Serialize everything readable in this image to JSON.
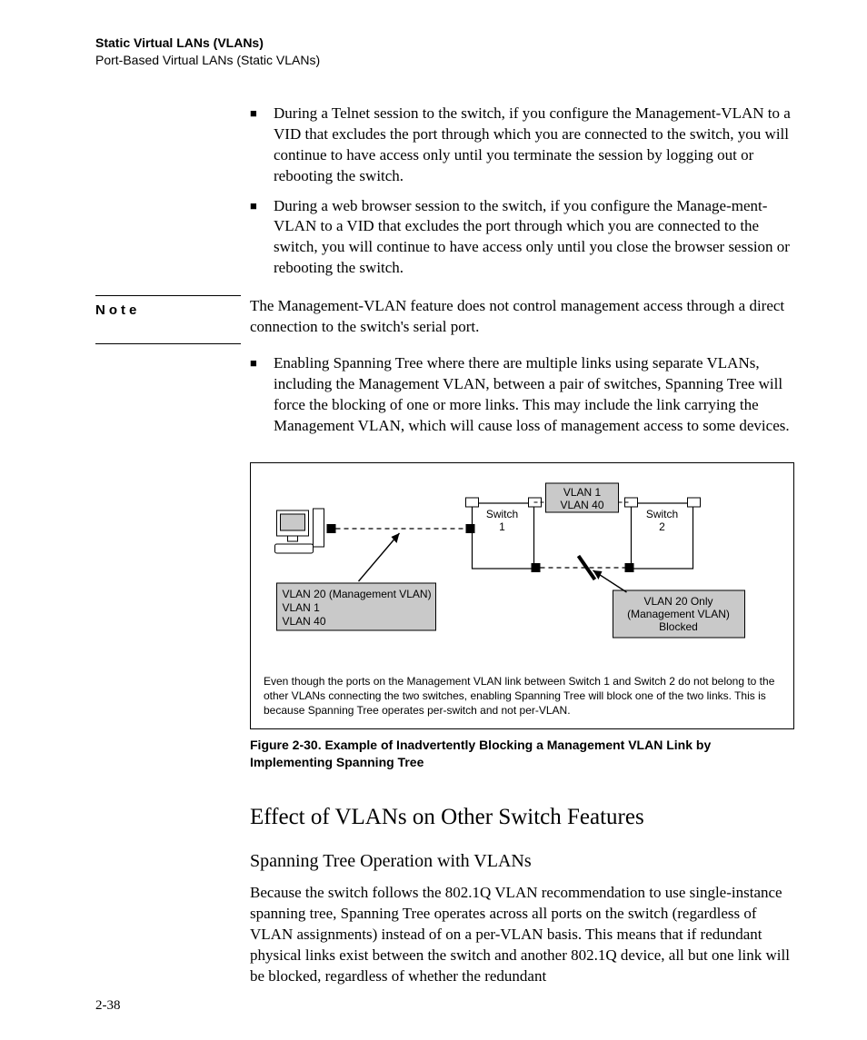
{
  "header": {
    "title": "Static Virtual LANs (VLANs)",
    "subtitle": "Port-Based Virtual LANs (Static VLANs)"
  },
  "bullets_top": [
    "During a Telnet session to the switch, if you configure the Management-VLAN to a VID that excludes the port through which you are connected to the switch, you will continue to have access only until you terminate the session by logging out or rebooting the switch.",
    "During a web browser session to the switch, if you configure the Manage-ment-VLAN to a VID that excludes the port through which you are connected to the switch, you will continue to have access only until you close the browser session or rebooting the switch."
  ],
  "note": {
    "label": "Note",
    "body": "The Management-VLAN feature does not control management access through a direct connection to the switch's serial port."
  },
  "bullets_mid": [
    "Enabling Spanning Tree where there are multiple links using separate VLANs, including the Management VLAN, between a pair of switches, Spanning Tree will force the blocking of one or more links. This may include the link carrying the Management VLAN, which will cause loss of management access to some devices."
  ],
  "figure": {
    "switch1": "Switch 1",
    "switch2": "Switch 2",
    "top_link_l1": "VLAN 1",
    "top_link_l2": "VLAN 40",
    "left_l1": "VLAN 20 (Management VLAN)",
    "left_l2": "VLAN 1",
    "left_l3": "VLAN 40",
    "right_l1": "VLAN 20 Only",
    "right_l2": "(Management VLAN)",
    "right_l3": "Blocked",
    "body_note": "Even though the ports on the Management VLAN link between Switch 1 and Switch 2 do not belong to the other VLANs connecting the two switches, enabling Spanning Tree will block one of the two links. This is because Spanning Tree operates per-switch and not per-VLAN.",
    "caption": "Figure 2-30.  Example of Inadvertently Blocking a Management VLAN Link by Implementing Spanning Tree"
  },
  "section": {
    "h1": "Effect of VLANs on Other Switch Features",
    "h2": "Spanning Tree Operation with VLANs",
    "para": "Because the switch follows the 802.1Q VLAN recommendation to use single-instance spanning tree, Spanning Tree operates across all ports on the switch (regardless of VLAN assignments) instead of on a per-VLAN basis. This means that if redundant physical links exist between the switch and another 802.1Q device, all but one link will be blocked, regardless of whether the redundant"
  },
  "page_number": "2-38"
}
